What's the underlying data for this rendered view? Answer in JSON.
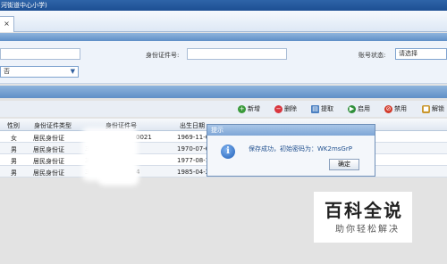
{
  "window": {
    "title": "河街道中心小学)"
  },
  "tabs": {
    "close_glyph": "×"
  },
  "search": {
    "id_label": "身份证件号:",
    "account_status_label": "账号状态:",
    "account_status_value": "请选择",
    "left_select_value": "否"
  },
  "toolbar": {
    "add": "新增",
    "delete": "删除",
    "extract": "提取",
    "enable": "启用",
    "disable": "禁用",
    "unlock": "解锁"
  },
  "table": {
    "headers": [
      "性别",
      "身份证件类型",
      "身份证件号",
      "出生日期"
    ],
    "rows": [
      {
        "gender": "女",
        "id_type": "居民身份证",
        "id_no": "0021",
        "birth": "1969-11-07"
      },
      {
        "gender": "男",
        "id_type": "居民身份证",
        "id_no": "3704",
        "birth": "1970-07-07"
      },
      {
        "gender": "男",
        "id_type": "居民身份证",
        "id_no": "370481",
        "birth": "1977-08-12"
      },
      {
        "gender": "男",
        "id_type": "居民身份证",
        "id_no": "370",
        "birth": "1985-04-25"
      }
    ],
    "row_tail": "4"
  },
  "dialog": {
    "title": "提示",
    "message": "保存成功，初始密码为：WK2msGrP",
    "ok": "确定",
    "icon": "info-icon"
  },
  "watermark": {
    "main": "百科全说",
    "sub": "助你轻松解决"
  }
}
